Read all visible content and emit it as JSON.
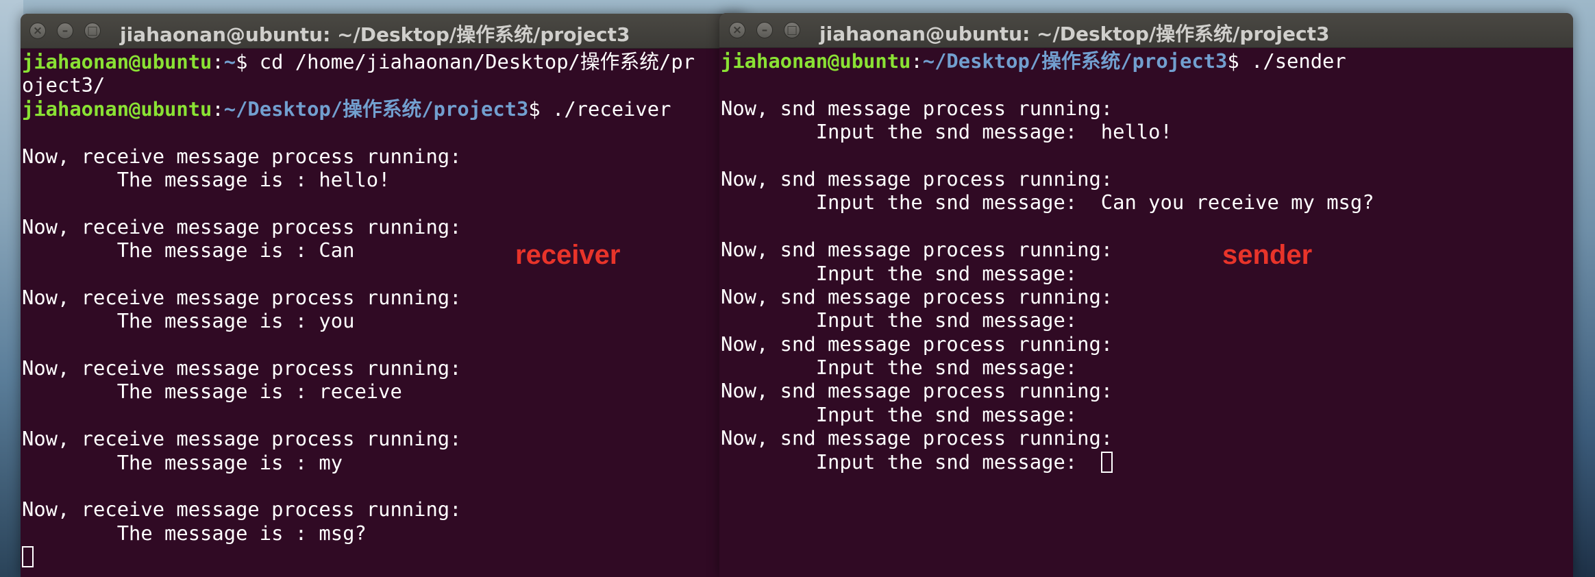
{
  "receiver_window": {
    "title": "jiahaonan@ubuntu: ~/Desktop/操作系统/project3",
    "buttons": [
      "×",
      "–",
      "□"
    ],
    "annotation": "receiver",
    "lines": [
      {
        "user": "jiahaonan@ubuntu",
        "sep": ":",
        "path": "~",
        "rest": "$ cd /home/jiahaonan/Desktop/操作系统/pr"
      },
      {
        "text": "oject3/"
      },
      {
        "user": "jiahaonan@ubuntu",
        "sep": ":",
        "path": "~/Desktop/操作系统/project3",
        "rest": "$ ./receiver"
      },
      {
        "text": ""
      },
      {
        "text": "Now, receive message process running:"
      },
      {
        "text": "        The message is : hello!"
      },
      {
        "text": ""
      },
      {
        "text": "Now, receive message process running:"
      },
      {
        "text": "        The message is : Can"
      },
      {
        "text": ""
      },
      {
        "text": "Now, receive message process running:"
      },
      {
        "text": "        The message is : you"
      },
      {
        "text": ""
      },
      {
        "text": "Now, receive message process running:"
      },
      {
        "text": "        The message is : receive"
      },
      {
        "text": ""
      },
      {
        "text": "Now, receive message process running:"
      },
      {
        "text": "        The message is : my"
      },
      {
        "text": ""
      },
      {
        "text": "Now, receive message process running:"
      },
      {
        "text": "        The message is : msg?"
      },
      {
        "text": "",
        "cursor": true
      }
    ]
  },
  "sender_window": {
    "title": "jiahaonan@ubuntu: ~/Desktop/操作系统/project3",
    "buttons": [
      "×",
      "–",
      "□"
    ],
    "annotation": "sender",
    "lines": [
      {
        "user": "jiahaonan@ubuntu",
        "sep": ":",
        "path": "~/Desktop/操作系统/project3",
        "rest": "$ ./sender"
      },
      {
        "text": ""
      },
      {
        "text": "Now, snd message process running:"
      },
      {
        "text": "        Input the snd message:  hello!"
      },
      {
        "text": ""
      },
      {
        "text": "Now, snd message process running:"
      },
      {
        "text": "        Input the snd message:  Can you receive my msg?"
      },
      {
        "text": ""
      },
      {
        "text": "Now, snd message process running:"
      },
      {
        "text": "        Input the snd message:"
      },
      {
        "text": "Now, snd message process running:"
      },
      {
        "text": "        Input the snd message:"
      },
      {
        "text": "Now, snd message process running:"
      },
      {
        "text": "        Input the snd message:"
      },
      {
        "text": "Now, snd message process running:"
      },
      {
        "text": "        Input the snd message:"
      },
      {
        "text": "Now, snd message process running:"
      },
      {
        "text": "        Input the snd message:  ",
        "cursor": true
      }
    ]
  },
  "colors": {
    "terminal_bg": "#300a24",
    "prompt_user": "#8ae234",
    "prompt_path": "#729fcf",
    "annotation": "#e8342a"
  }
}
